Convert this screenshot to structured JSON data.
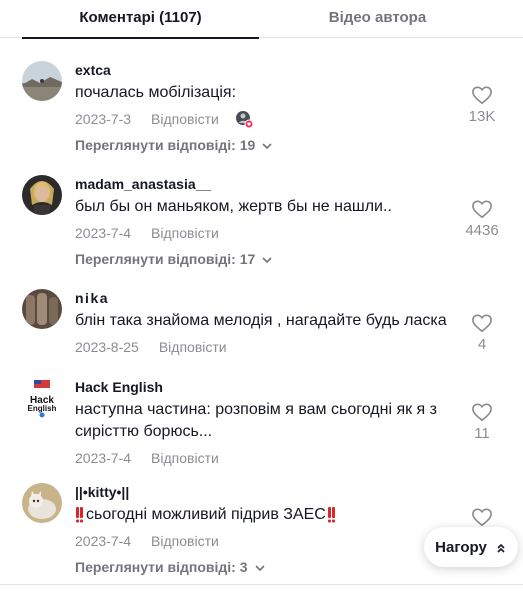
{
  "tabs": {
    "comments": "Коментарі (1107)",
    "author_videos": "Відео автора"
  },
  "reply_label": "Відповісти",
  "comments": [
    {
      "username": "extca",
      "text": "почалась мобілізація:",
      "date": "2023-7-3",
      "likes": "13K",
      "view_replies": "Переглянути відповіді: 19"
    },
    {
      "username": "madam_anastasia__",
      "text": "был бы он маньяком, жертв бы не нашли..",
      "date": "2023-7-4",
      "likes": "4436",
      "view_replies": "Переглянути відповіді: 17"
    },
    {
      "username": "nika",
      "text": "блін така знайома мелодія , нагадайте будь ласка",
      "date": "2023-8-25",
      "likes": "4"
    },
    {
      "username": "Hack English",
      "text": "наступна частина: розповім я вам сьогодні як я з сирісттю борюсь...",
      "date": "2023-7-4",
      "likes": "11"
    },
    {
      "username": "||•kitty•||",
      "text": "сьогодні можливий підрив ЗАЕС",
      "date": "2023-7-4",
      "likes": "",
      "view_replies": "Переглянути відповіді: 3"
    }
  ],
  "back_to_top": "Нагору",
  "colors": {
    "text": "#161823",
    "muted": "#8a8b91",
    "accent": "#fe2c55"
  }
}
